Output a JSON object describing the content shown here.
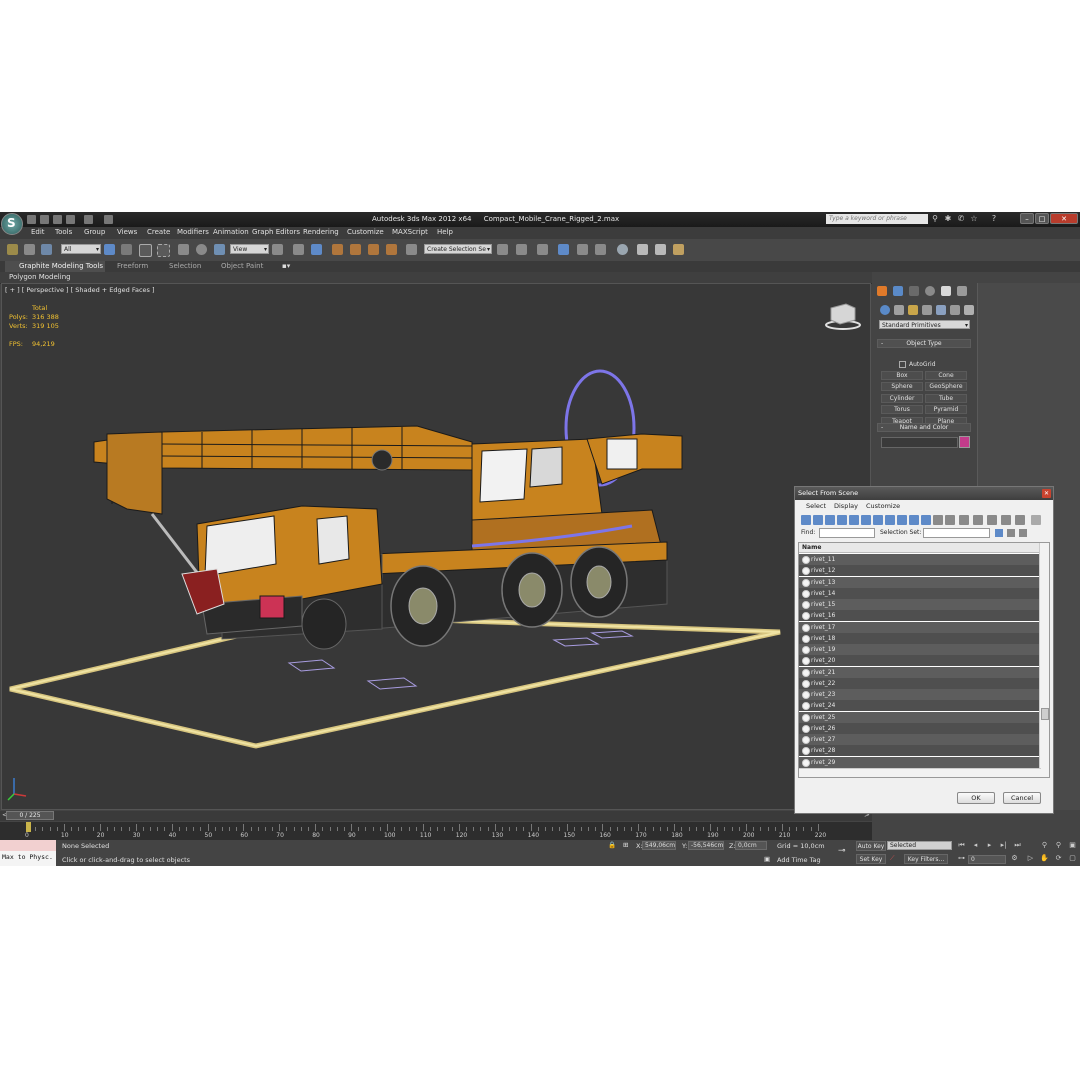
{
  "window": {
    "app_title": "Autodesk 3ds Max  2012 x64",
    "file_name": "Compact_Mobile_Crane_Rigged_2.max",
    "search_placeholder": "Type a keyword or phrase"
  },
  "menu": [
    "Edit",
    "Tools",
    "Group",
    "Views",
    "Create",
    "Modifiers",
    "Animation",
    "Graph Editors",
    "Rendering",
    "Customize",
    "MAXScript",
    "Help"
  ],
  "toolbar": {
    "selection_filter": "All",
    "reference_coord": "View",
    "named_selection": "Create Selection Se"
  },
  "ribbon": {
    "tabs": [
      "Graphite Modeling Tools",
      "Freeform",
      "Selection",
      "Object Paint"
    ],
    "panel_label": "Polygon Modeling"
  },
  "viewport": {
    "label": "[ + ] [ Perspective ] [ Shaded + Edged Faces ]",
    "stats": {
      "total_label": "Total",
      "polys_label": "Polys:",
      "polys_value": "316 388",
      "verts_label": "Verts:",
      "verts_value": "319 105",
      "fps_label": "FPS:",
      "fps_value": "94,219"
    }
  },
  "command_panel": {
    "category": "Standard Primitives",
    "object_type_header": "Object Type",
    "autogrid_label": "AutoGrid",
    "buttons": [
      "Box",
      "Cone",
      "Sphere",
      "GeoSphere",
      "Cylinder",
      "Tube",
      "Torus",
      "Pyramid",
      "Teapot",
      "Plane"
    ],
    "name_color_header": "Name and Color",
    "color": "#c23b8a"
  },
  "dialog": {
    "title": "Select From Scene",
    "menu": [
      "Select",
      "Display",
      "Customize"
    ],
    "find_label": "Find:",
    "selection_set_label": "Selection Set:",
    "column_name": "Name",
    "items": [
      "rivet_11",
      "rivet_12",
      "rivet_13",
      "rivet_14",
      "rivet_15",
      "rivet_16",
      "rivet_17",
      "rivet_18",
      "rivet_19",
      "rivet_20",
      "rivet_21",
      "rivet_22",
      "rivet_23",
      "rivet_24",
      "rivet_25",
      "rivet_26",
      "rivet_27",
      "rivet_28",
      "rivet_29",
      "rivet_30"
    ],
    "selected_item": "rivet_30",
    "ok_label": "OK",
    "cancel_label": "Cancel"
  },
  "timeline": {
    "frame_display": "0 / 225",
    "ticks": [
      "0",
      "10",
      "20",
      "30",
      "40",
      "50",
      "60",
      "70",
      "80",
      "90",
      "100",
      "110",
      "120",
      "130",
      "140",
      "150",
      "160",
      "170",
      "180",
      "190",
      "200",
      "210",
      "220"
    ]
  },
  "status": {
    "maxscript_label": "Max to Physc.",
    "selection_status": "None Selected",
    "prompt": "Click or click-and-drag to select objects",
    "x_label": "X:",
    "x_value": "549,06cm",
    "y_label": "Y:",
    "y_value": "-56,546cm",
    "z_label": "Z:",
    "z_value": "0,0cm",
    "grid": "Grid = 10,0cm",
    "add_time_tag": "Add Time Tag",
    "auto_key": "Auto Key",
    "set_key": "Set Key",
    "key_mode": "Selected",
    "key_filters": "Key Filters...",
    "current_frame": "0"
  }
}
